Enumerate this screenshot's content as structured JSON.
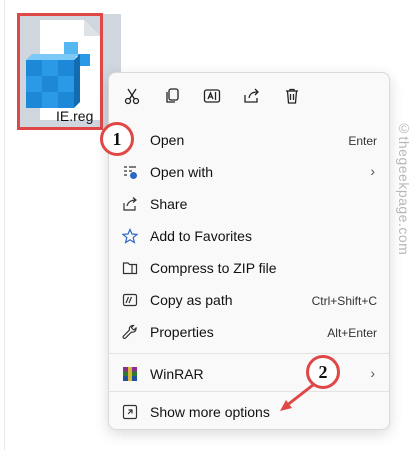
{
  "file": {
    "name": "IE.reg"
  },
  "menu": {
    "items": [
      {
        "label": "Open",
        "shortcut": "Enter"
      },
      {
        "label": "Open with",
        "shortcut": ""
      },
      {
        "label": "Share",
        "shortcut": ""
      },
      {
        "label": "Add to Favorites",
        "shortcut": ""
      },
      {
        "label": "Compress to ZIP file",
        "shortcut": ""
      },
      {
        "label": "Copy as path",
        "shortcut": "Ctrl+Shift+C"
      },
      {
        "label": "Properties",
        "shortcut": "Alt+Enter"
      },
      {
        "label": "WinRAR",
        "shortcut": ""
      },
      {
        "label": "Show more options",
        "shortcut": ""
      }
    ]
  },
  "annotations": {
    "step1": "1",
    "step2": "2"
  },
  "watermark": "©thegeekpage.com",
  "colors": {
    "highlight": "#e04848",
    "menu_bg": "#f9f9f9",
    "accent": "#2b66c4"
  }
}
